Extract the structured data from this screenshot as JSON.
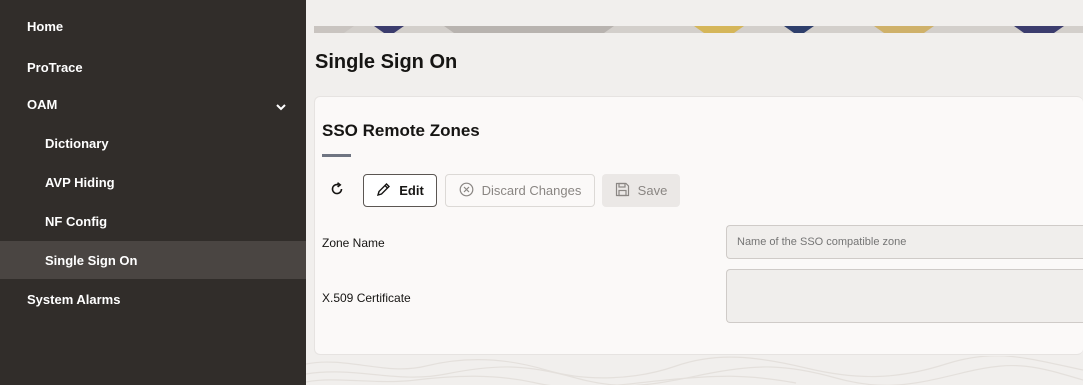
{
  "sidebar": {
    "items": [
      {
        "label": "Home"
      },
      {
        "label": "ProTrace"
      },
      {
        "label": "OAM"
      },
      {
        "label": "Dictionary"
      },
      {
        "label": "AVP Hiding"
      },
      {
        "label": "NF Config"
      },
      {
        "label": "Single Sign On"
      },
      {
        "label": "System Alarms"
      }
    ],
    "active": "Single Sign On"
  },
  "page": {
    "title": "Single Sign On"
  },
  "section": {
    "title": "SSO Remote Zones"
  },
  "toolbar": {
    "edit_label": "Edit",
    "discard_label": "Discard Changes",
    "save_label": "Save"
  },
  "form": {
    "zone_name": {
      "label": "Zone Name",
      "placeholder": "Name of the SSO compatible zone",
      "value": ""
    },
    "certificate": {
      "label": "X.509 Certificate",
      "value": ""
    }
  },
  "icons": {
    "refresh": "refresh-icon",
    "edit": "pencil-icon",
    "discard": "circle-x-icon",
    "save": "floppy-disk-icon",
    "expand": "chevron-down-icon"
  },
  "colors": {
    "sidebar_bg": "#312d2a",
    "sidebar_active_bg": "#4a4542",
    "page_bg": "#f1efed",
    "card_bg": "#fbf9f8",
    "accent_rule": "#6f7582"
  }
}
